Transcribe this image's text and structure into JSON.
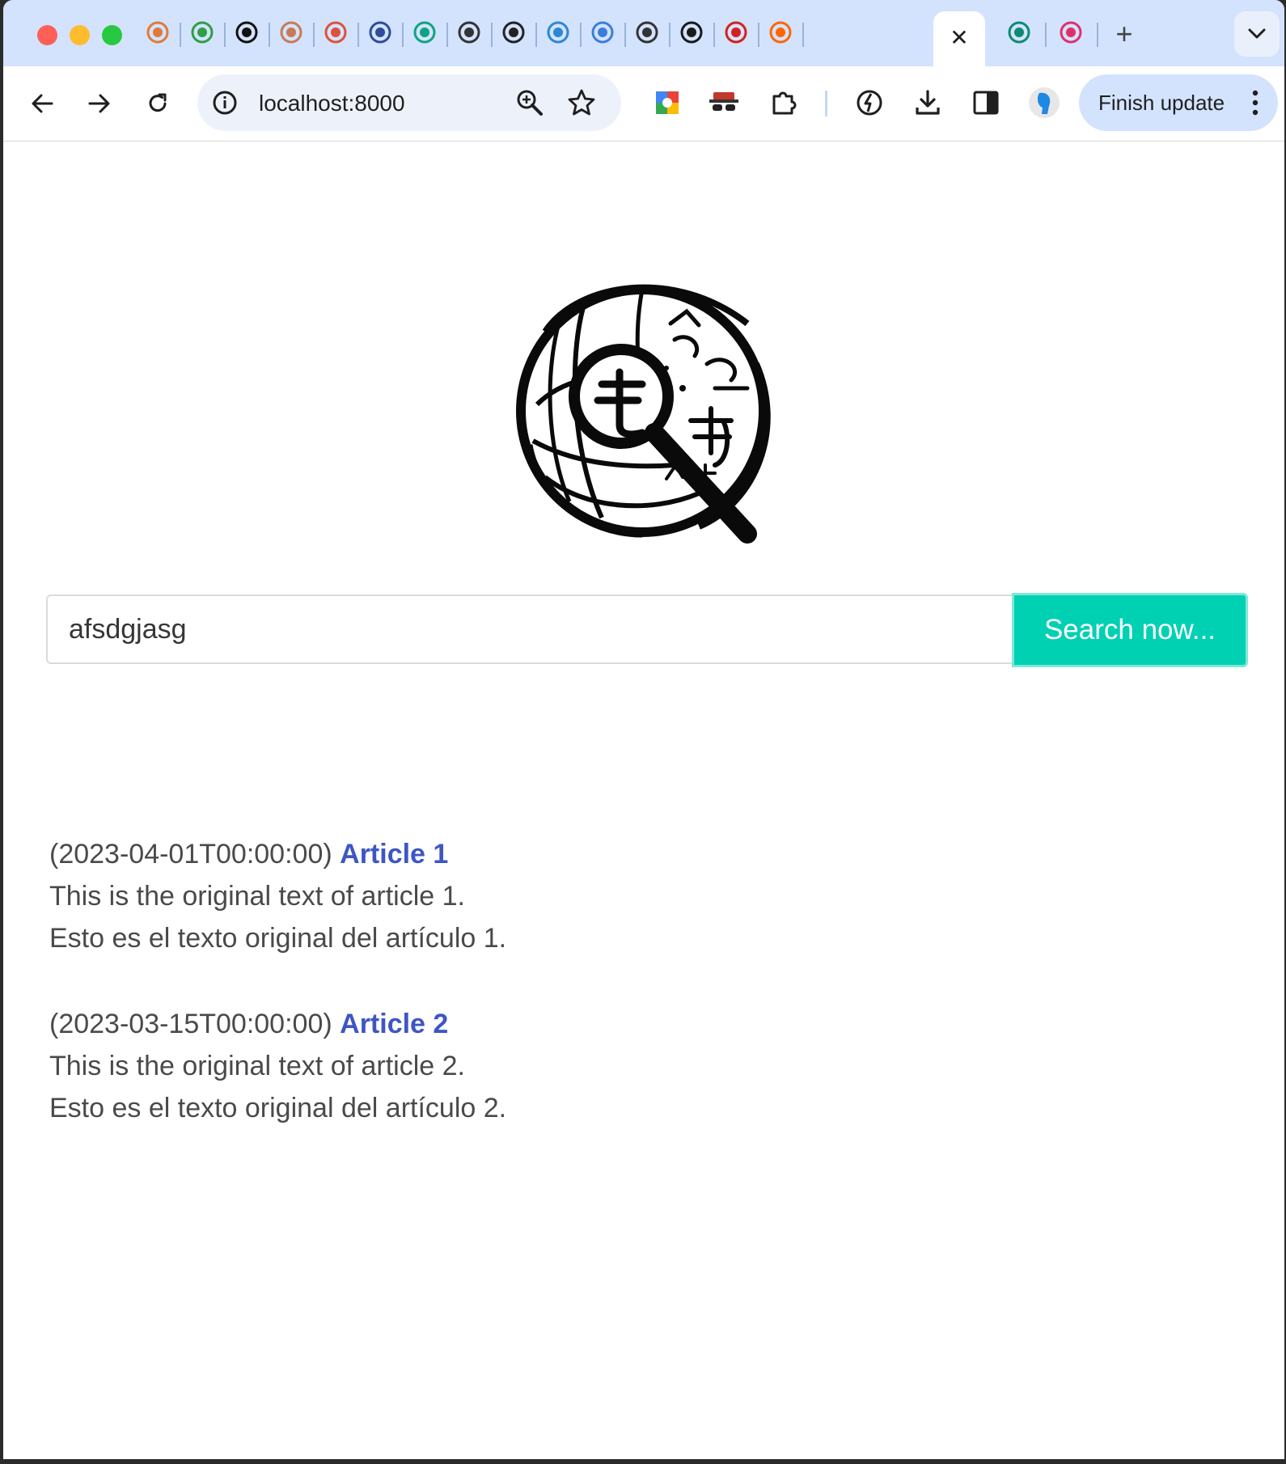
{
  "browser": {
    "tabs": [
      {
        "icon": "swirl-favicon-icon",
        "color": "#e07a3a"
      },
      {
        "icon": "green-spiral-favicon-icon",
        "color": "#2f9e44"
      },
      {
        "icon": "github-icon",
        "color": "#111111"
      },
      {
        "icon": "anthropic-icon",
        "color": "#c97a55"
      },
      {
        "icon": "red-square-favicon-icon",
        "color": "#e0503a"
      },
      {
        "icon": "abc-favicon-icon",
        "color": "#2d4d9a"
      },
      {
        "icon": "chatgpt-icon",
        "color": "#10a37f"
      },
      {
        "icon": "openai-icon",
        "color": "#333333"
      },
      {
        "icon": "x-circle-favicon-icon",
        "color": "#222222"
      },
      {
        "icon": "heart-favicon-icon",
        "color": "#2d86d8"
      },
      {
        "icon": "z-favicon-icon",
        "color": "#3b7ddd"
      },
      {
        "icon": "gpt-dark-favicon-icon",
        "color": "#333333"
      },
      {
        "icon": "x-app-favicon-icon",
        "color": "#1a1a1a"
      },
      {
        "icon": "letter-a-favicon-icon",
        "color": "#d32020"
      },
      {
        "icon": "hacker-news-icon",
        "color": "#ff6600"
      }
    ],
    "active_tab_close": "✕",
    "trailing_tabs": [
      {
        "icon": "green-leaf-favicon-icon",
        "color": "#0e8a72"
      },
      {
        "icon": "pink-pyramid-favicon-icon",
        "color": "#e0306a"
      }
    ],
    "new_tab": "+",
    "url": "localhost:8000",
    "finish_update_label": "Finish update"
  },
  "search": {
    "value": "afsdgjasg",
    "button_label": "Search now..."
  },
  "results": [
    {
      "date": "(2023-04-01T00:00:00)",
      "title": "Article 1",
      "original": "This is the original text of article 1.",
      "translation": "Esto es el texto original del artículo 1."
    },
    {
      "date": "(2023-03-15T00:00:00)",
      "title": "Article 2",
      "original": "This is the original text of article 2.",
      "translation": "Esto es el texto original del artículo 2."
    }
  ],
  "colors": {
    "accent": "#00d1b2",
    "link": "#3e56c4",
    "tabstrip": "#d3e3fd"
  }
}
